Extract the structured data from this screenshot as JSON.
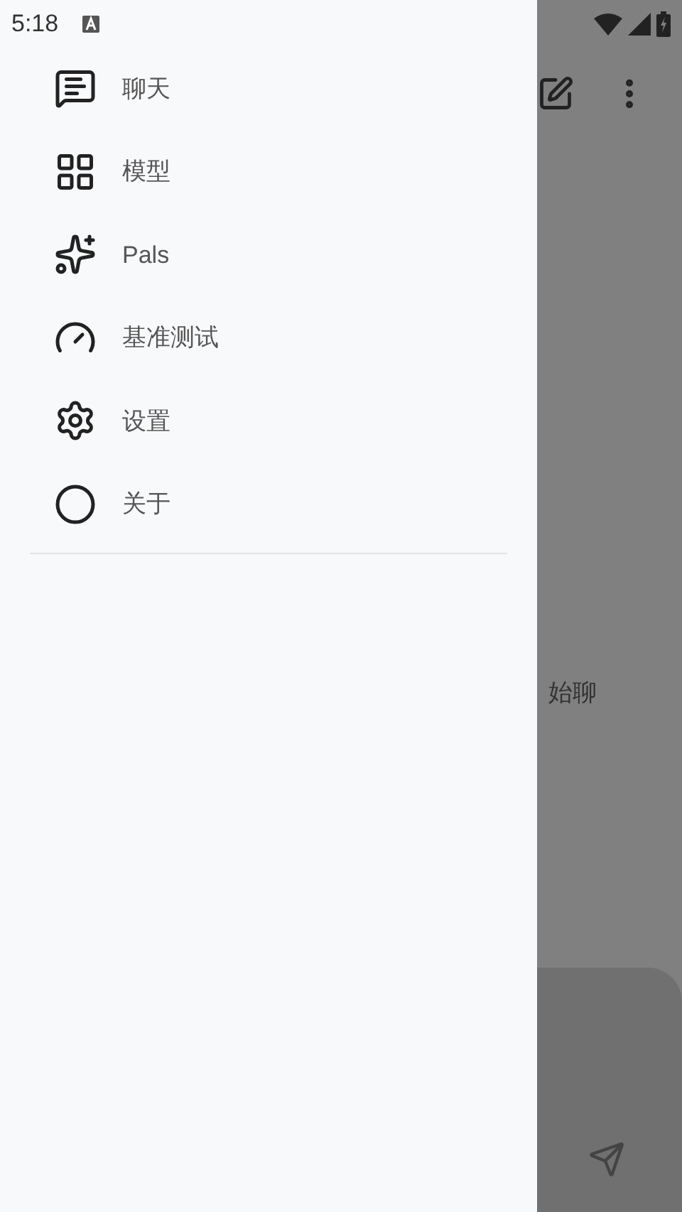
{
  "status_bar": {
    "time": "5:18"
  },
  "drawer": {
    "items": [
      {
        "label": "聊天"
      },
      {
        "label": "模型"
      },
      {
        "label": "Pals"
      },
      {
        "label": "基准测试"
      },
      {
        "label": "设置"
      },
      {
        "label": "关于"
      }
    ]
  },
  "background_page": {
    "message": "始聊"
  }
}
